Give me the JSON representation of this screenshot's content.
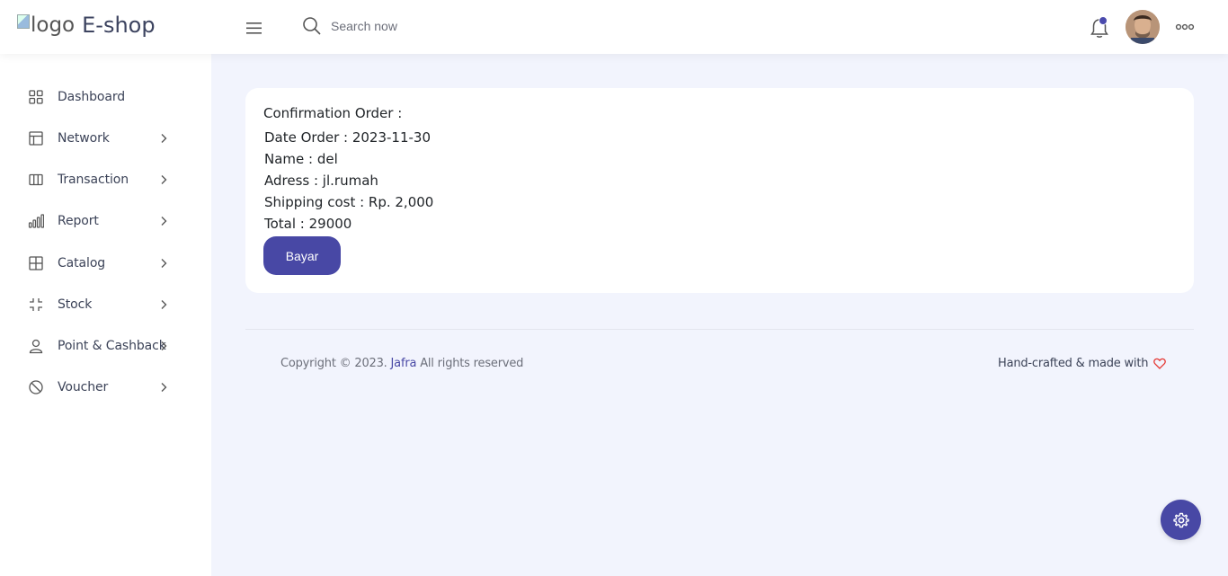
{
  "header": {
    "logo_alt": "logo",
    "brand": "E-shop",
    "search_placeholder": "Search now",
    "notification_dot_color": "#4a4aad"
  },
  "sidebar": {
    "items": [
      {
        "label": "Dashboard",
        "icon": "grid-icon",
        "has_chevron": false
      },
      {
        "label": "Network",
        "icon": "layout-icon",
        "has_chevron": true
      },
      {
        "label": "Transaction",
        "icon": "columns-icon",
        "has_chevron": true
      },
      {
        "label": "Report",
        "icon": "bar-chart-icon",
        "has_chevron": true
      },
      {
        "label": "Catalog",
        "icon": "table-icon",
        "has_chevron": true
      },
      {
        "label": "Stock",
        "icon": "minimize-icon",
        "has_chevron": true
      },
      {
        "label": "Point & Cashback",
        "icon": "user-icon",
        "has_chevron": true
      },
      {
        "label": "Voucher",
        "icon": "slash-icon",
        "has_chevron": true
      }
    ]
  },
  "order": {
    "title": "Confirmation Order :",
    "date_line": "Date Order : 2023-11-30",
    "name_line": "Name : del",
    "address_line": "Adress : jl.rumah",
    "shipping_line": "Shipping cost : Rp. 2,000",
    "total_line": "Total : 29000",
    "pay_button": "Bayar"
  },
  "footer": {
    "copyright_prefix": "Copyright © 2023.",
    "company": "Jafra",
    "copyright_suffix": "All rights reserved",
    "crafted": "Hand-crafted & made with"
  },
  "colors": {
    "accent": "#4848a5",
    "page_bg": "#f2f4fd",
    "heart": "#e53935"
  }
}
